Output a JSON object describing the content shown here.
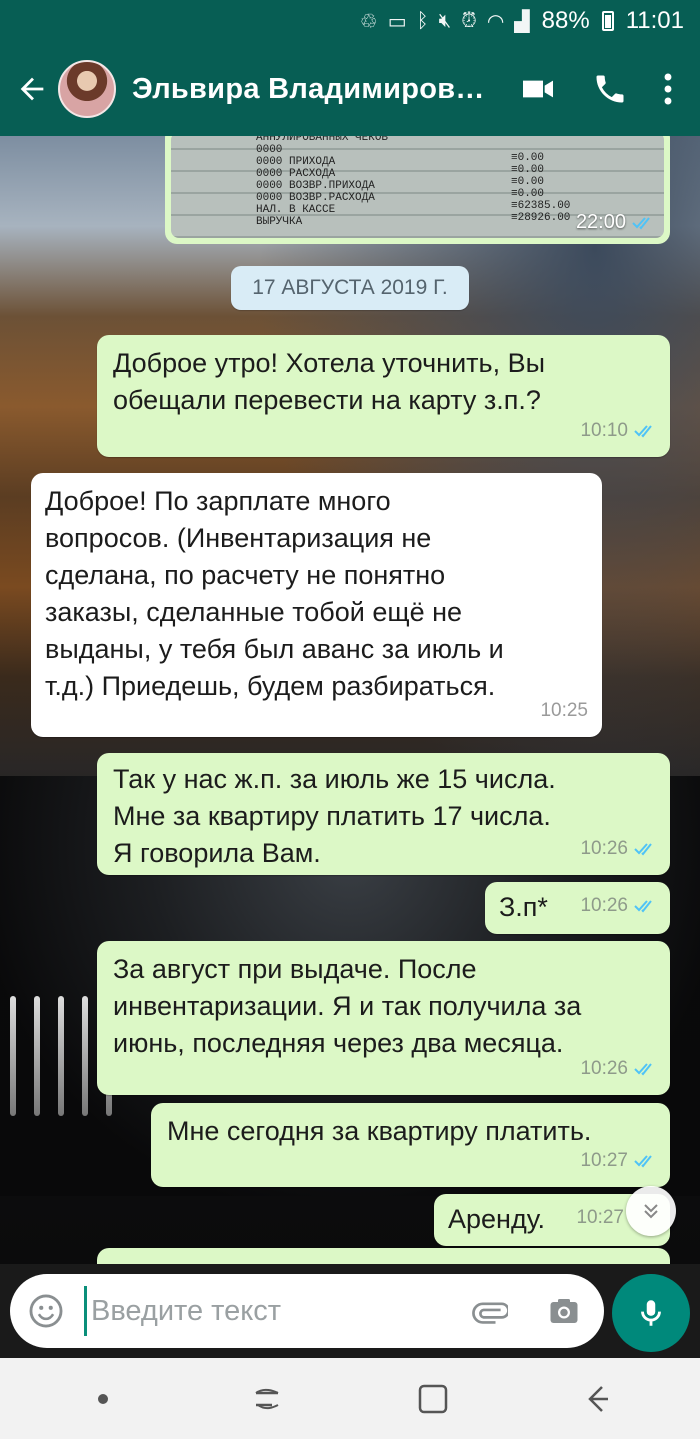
{
  "status_bar": {
    "battery": "88%",
    "time": "11:01"
  },
  "header": {
    "contact_name": "Эльвира Владимиров…"
  },
  "receipt": {
    "lines": "АННУЛИРОВАННЫХ ЧЕКОВ\n0000\n0000 ПРИХОДА\n0000 РАСХОДА\n0000 ВОЗВР.ПРИХОДА\n0000 ВОЗВР.РАСХОДА\nНАЛ. В КАССЕ\nВЫРУЧКА",
    "values": "≡0.00\n≡0.00\n≡0.00\n≡0.00\n≡62385.00\n≡28926.00",
    "time": "22:00"
  },
  "date_chip": "17 АВГУСТА 2019 Г.",
  "messages": [
    {
      "dir": "out",
      "text": "Доброе утро! Хотела уточнить, Вы\nобещали перевести на карту з.п.?",
      "time": "10:10"
    },
    {
      "dir": "in",
      "text": "Доброе! По зарплате много\nвопросов. (Инвентаризация не\nсделана, по расчету не понятно\nзаказы, сделанные тобой ещё не\nвыданы, у тебя был аванс за июль и\nт.д.) Приедешь, будем разбираться.",
      "time": "10:25"
    },
    {
      "dir": "out",
      "text": "Так у нас ж.п. за июль же 15 числа.\nМне за квартиру платить 17 числа.\nЯ говорила Вам.",
      "time": "10:26"
    },
    {
      "dir": "out",
      "text": "З.п*",
      "time": "10:26"
    },
    {
      "dir": "out",
      "text": "За август при выдаче. После\nинвентаризации. Я и так получила за\nиюнь, последняя через два месяца.",
      "time": "10:26"
    },
    {
      "dir": "out",
      "text": "Мне сегодня за квартиру платить.",
      "time": "10:27"
    },
    {
      "dir": "out",
      "text": "Аренду.",
      "time": "10:27"
    }
  ],
  "input": {
    "placeholder": "Введите текст"
  },
  "colors": {
    "header": "#075e54",
    "outgoing": "#dcf8c6",
    "incoming": "#ffffff",
    "tick": "#4fc3f7",
    "mic": "#00897b"
  }
}
